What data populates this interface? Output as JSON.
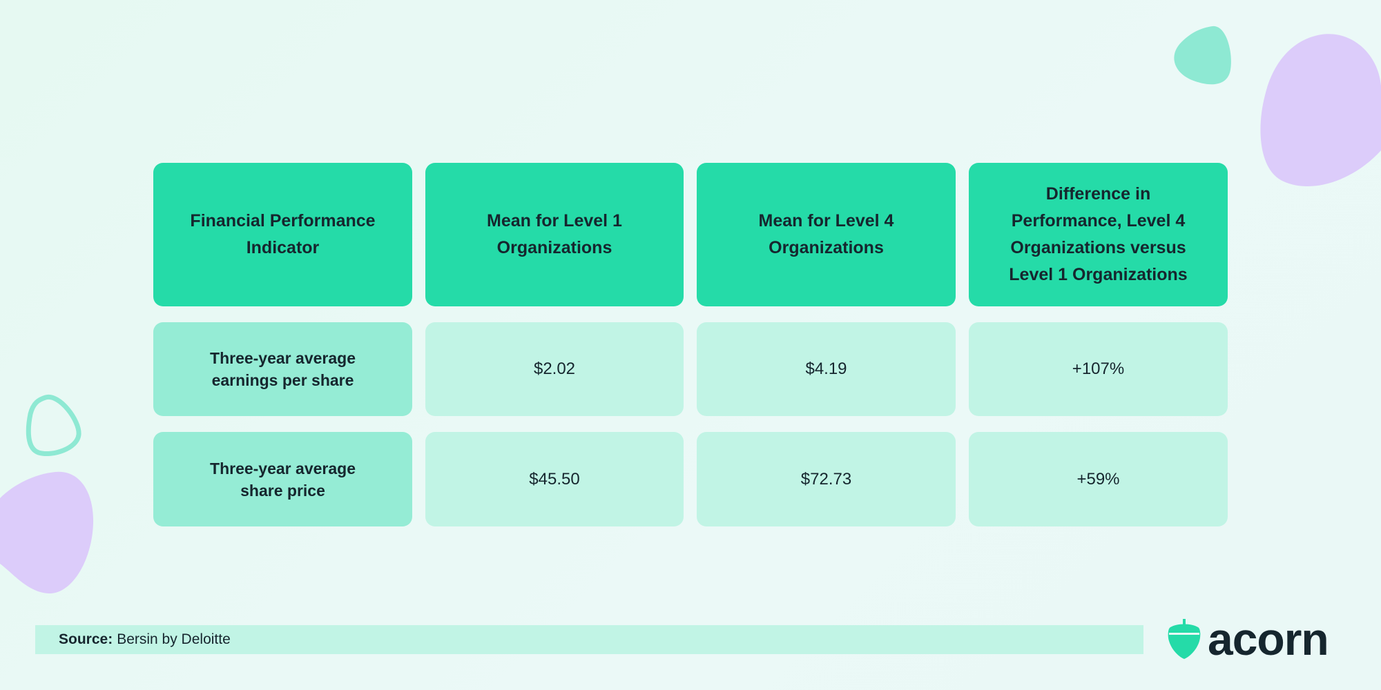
{
  "table": {
    "headers": [
      "Financial Performance Indicator",
      "Mean for Level 1 Organizations",
      "Mean for Level 4 Organizations",
      "Difference in Performance, Level 4 Organizations versus Level 1 Organizations"
    ],
    "rows": [
      {
        "indicator": "Three-year average earnings per share",
        "level1": "$2.02",
        "level4": "$4.19",
        "difference": "+107%"
      },
      {
        "indicator": "Three-year average share price",
        "level1": "$45.50",
        "level4": "$72.73",
        "difference": "+59%"
      }
    ]
  },
  "source": {
    "label": "Source:",
    "text": "Bersin by Deloitte"
  },
  "logo": {
    "text": "acorn",
    "icon": "acorn-icon"
  },
  "colors": {
    "header": "#25dba8",
    "label_cell": "#95ecd5",
    "value_cell": "#c1f4e5",
    "text": "#16262e",
    "purple": "#dcccfa"
  }
}
